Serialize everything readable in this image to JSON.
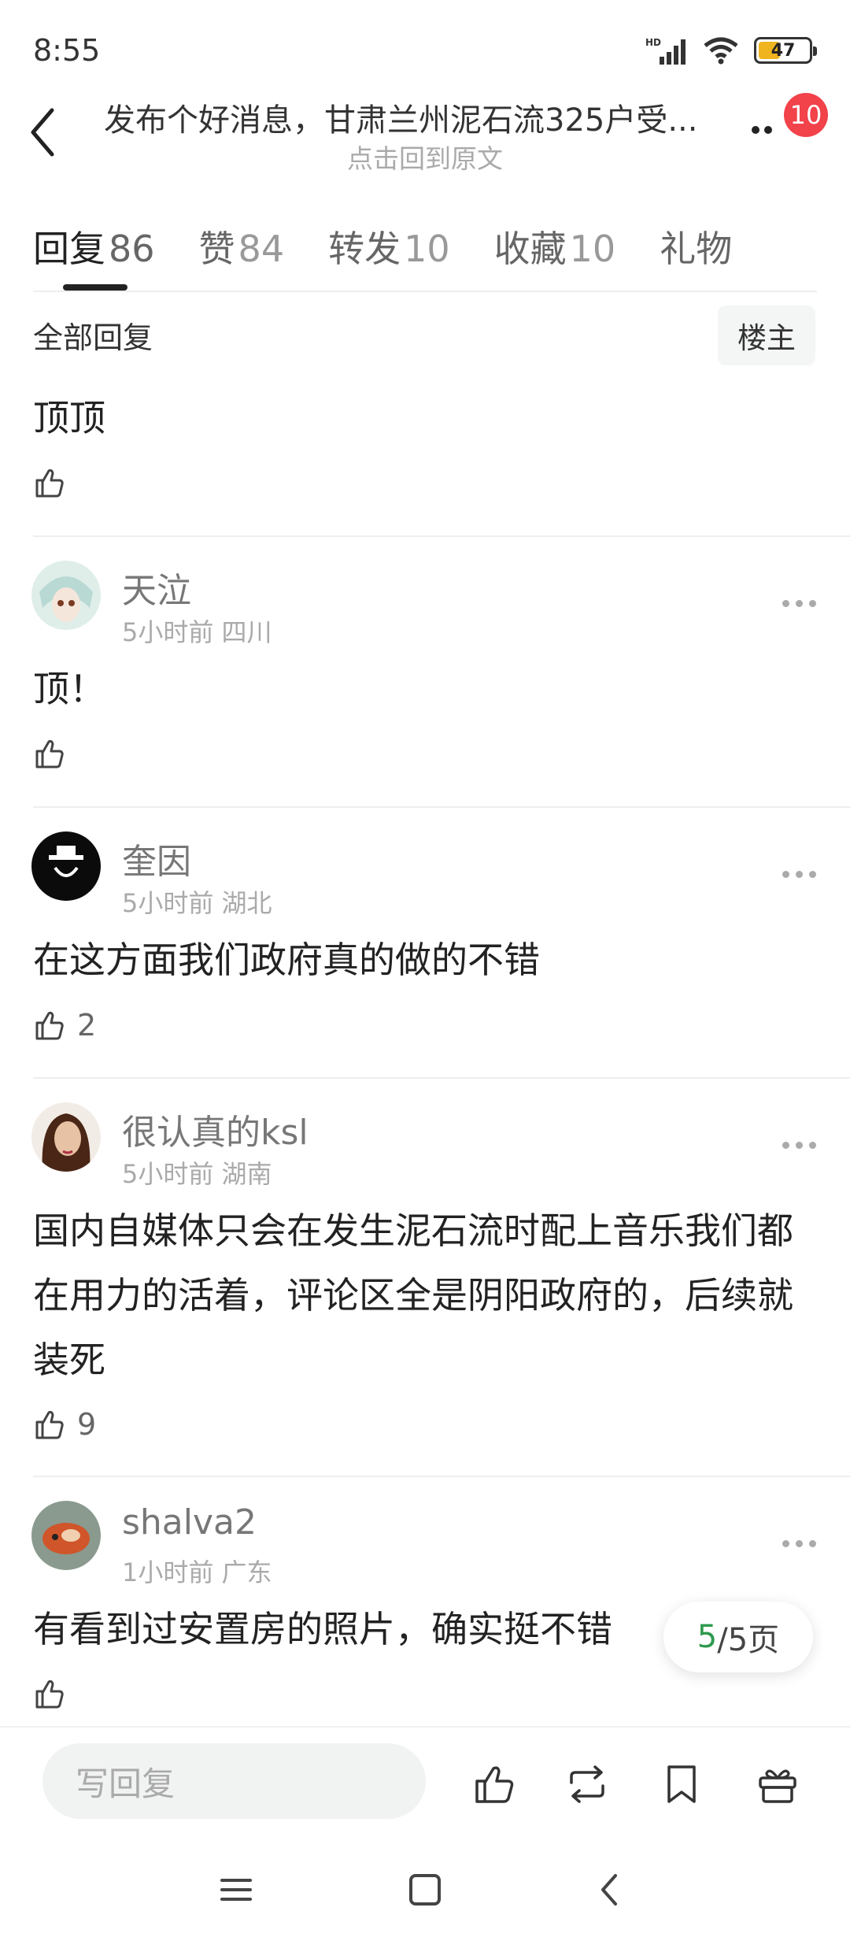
{
  "status_bar": {
    "time": "8:55",
    "battery": "47"
  },
  "header": {
    "title": "发布个好消息，甘肃兰州泥石流325户受...",
    "subtitle": "点击回到原文",
    "badge_count": "10"
  },
  "tabs": [
    {
      "label": "回复",
      "count": "86"
    },
    {
      "label": "赞",
      "count": "84"
    },
    {
      "label": "转发",
      "count": "10"
    },
    {
      "label": "收藏",
      "count": "10"
    },
    {
      "label": "礼物",
      "count": ""
    }
  ],
  "filter": {
    "all_label": "全部回复",
    "op_label": "楼主"
  },
  "comments": [
    {
      "text": "顶顶",
      "likes": ""
    },
    {
      "user": "天泣",
      "meta": "5小时前 四川",
      "text": "顶！",
      "likes": ""
    },
    {
      "user": "奎因",
      "meta": "5小时前 湖北",
      "text": "在这方面我们政府真的做的不错",
      "likes": "2"
    },
    {
      "user": "很认真的ksl",
      "meta": "5小时前 湖南",
      "text": "国内自媒体只会在发生泥石流时配上音乐我们都在用力的活着，评论区全是阴阳政府的，后续就装死",
      "likes": "9"
    },
    {
      "user": "shalva2",
      "meta": "1小时前 广东",
      "text": "有看到过安置房的照片，确实挺不错",
      "likes": ""
    }
  ],
  "pagination": {
    "current": "5",
    "total_text": "/5页"
  },
  "bottom_bar": {
    "reply_placeholder": "写回复"
  },
  "icons": [
    "back-icon",
    "more-icon",
    "like-icon",
    "repost-icon",
    "bookmark-icon",
    "gift-icon",
    "menu-icon",
    "home-icon",
    "nav-back-icon"
  ],
  "colors": {
    "badge": "#f2424a",
    "page_current": "#2e9a4e",
    "input_bg": "#f1f3f2"
  }
}
